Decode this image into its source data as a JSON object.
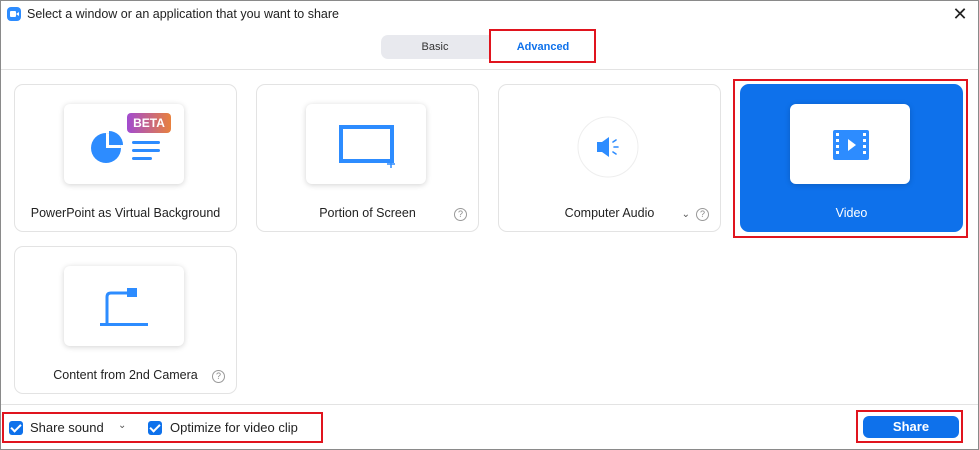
{
  "window": {
    "title": "Select a window or an application that you want to share",
    "close_symbol": "✕"
  },
  "tabs": [
    {
      "label": "Basic",
      "selected": false
    },
    {
      "label": "Advanced",
      "selected": true
    }
  ],
  "options": [
    {
      "label": "PowerPoint as Virtual Background",
      "badge": "BETA",
      "icon": "powerpoint-background-icon",
      "selected": false
    },
    {
      "label": "Portion of Screen",
      "icon": "screen-portion-icon",
      "help": "?",
      "selected": false
    },
    {
      "label": "Computer Audio",
      "icon": "speaker-icon",
      "help": "?",
      "caret": "⌄",
      "selected": false
    },
    {
      "label": "Video",
      "icon": "video-film-icon",
      "selected": true
    },
    {
      "label": "Content from 2nd Camera",
      "icon": "document-camera-icon",
      "help": "?",
      "selected": false
    }
  ],
  "footer": {
    "share_sound": {
      "label": "Share sound",
      "checked": true,
      "caret": "⌄"
    },
    "optimize_video": {
      "label": "Optimize for video clip",
      "checked": true
    },
    "share_button": "Share"
  },
  "colors": {
    "accent": "#0e71eb",
    "highlight_box": "#e0141e",
    "beta_gradient_start": "#a24bd0",
    "beta_gradient_end": "#e8813d"
  }
}
